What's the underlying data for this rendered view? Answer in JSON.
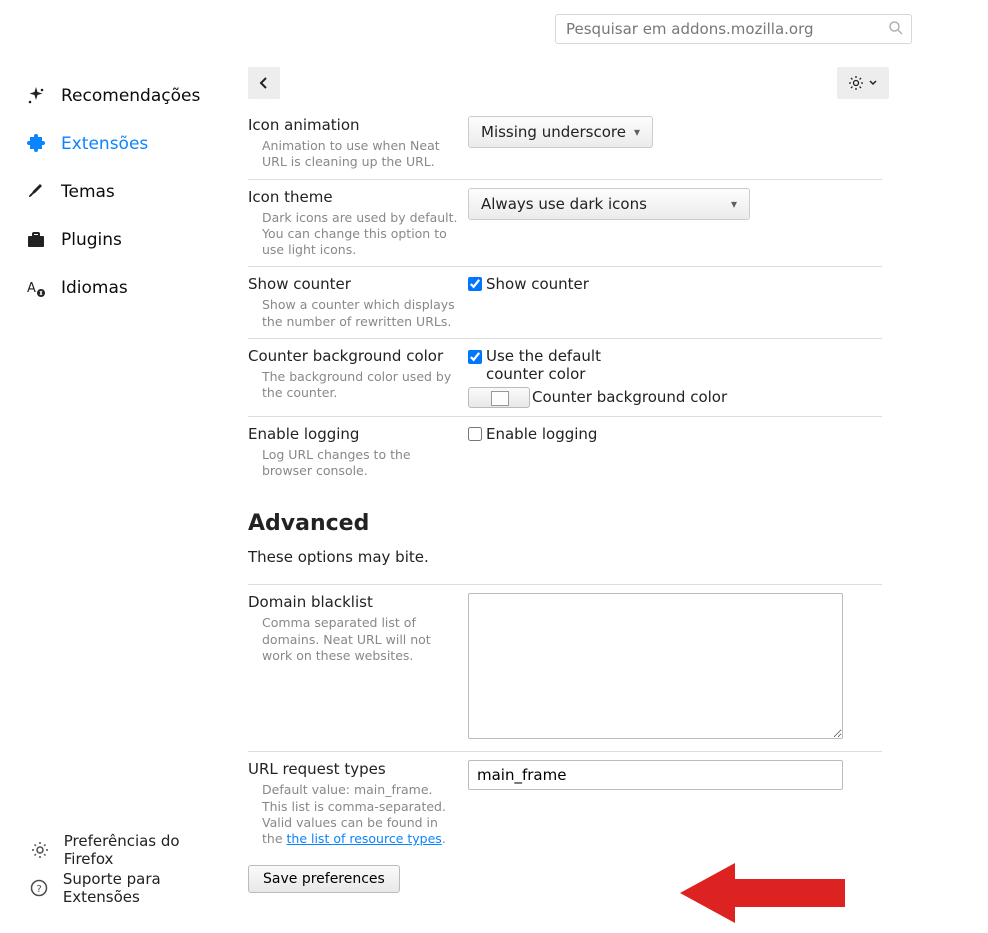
{
  "search": {
    "placeholder": "Pesquisar em addons.mozilla.org"
  },
  "sidebar": {
    "items": [
      {
        "label": "Recomendações"
      },
      {
        "label": "Extensões"
      },
      {
        "label": "Temas"
      },
      {
        "label": "Plugins"
      },
      {
        "label": "Idiomas"
      }
    ],
    "bottom": [
      {
        "label": "Preferências do Firefox"
      },
      {
        "label": "Suporte para Extensões"
      }
    ]
  },
  "opt": {
    "iconAnim": {
      "label": "Icon animation",
      "desc": "Animation to use when Neat URL is cleaning up the URL.",
      "value": "Missing underscore"
    },
    "iconTheme": {
      "label": "Icon theme",
      "desc": "Dark icons are used by default. You can change this option to use light icons.",
      "value": "Always use dark icons"
    },
    "showCounter": {
      "label": "Show counter",
      "desc": "Show a counter which displays the number of rewritten URLs.",
      "cb": "Show counter"
    },
    "counterBg": {
      "label": "Counter background color",
      "desc": "The background color used by the counter.",
      "cb": "Use the default counter color",
      "sw": "Counter background color"
    },
    "logging": {
      "label": "Enable logging",
      "desc": "Log URL changes to the browser console.",
      "cb": "Enable logging"
    }
  },
  "adv": {
    "heading": "Advanced",
    "hint": "These options may bite.",
    "blacklist": {
      "label": "Domain blacklist",
      "desc": "Comma separated list of domains. Neat URL will not work on these websites.",
      "value": ""
    },
    "reqtypes": {
      "label": "URL request types",
      "desc1": "Default value: main_frame. This list is comma-separated. Valid values can be found in the ",
      "link": "the list of resource types",
      "desc2": ".",
      "value": "main_frame"
    },
    "save": "Save preferences"
  }
}
